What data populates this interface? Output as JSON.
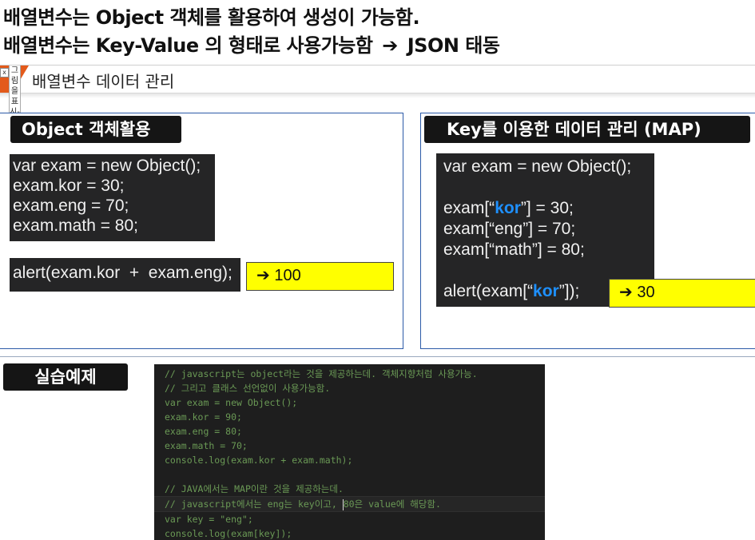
{
  "headings": {
    "line1": "배열변수는 Object 객체를 활용하여 생성이 가능함.",
    "line2_part1": "배열변수는 Key-Value 의 형태로 사용가능함",
    "line2_arrow": "➔",
    "line2_part2": "JSON 태동"
  },
  "section": {
    "title": "배열변수 데이터 관리",
    "tag_close": "x",
    "vertical_text": "그림을표시-어"
  },
  "panel_left": {
    "label": "Object 객체활용",
    "code": [
      "var exam = new Object();",
      "exam.kor = 30;",
      "exam.eng = 70;",
      "exam.math = 80;"
    ],
    "alert_code": "alert(exam.kor  +  exam.eng);",
    "result_arrow": "➔",
    "result_value": "100"
  },
  "panel_right": {
    "label": "Key를 이용한 데이터 관리 (MAP)",
    "line1": "var exam = new Object();",
    "line2_pre": "exam[“",
    "line2_key": "kor",
    "line2_post": "”] = 30;",
    "line3": "exam[“eng”] = 70;",
    "line4": "exam[“math”] = 80;",
    "line5_pre": "alert(exam[“",
    "line5_key": "kor",
    "line5_post": "”]);",
    "result_arrow": "➔",
    "result_value": "30"
  },
  "practice": {
    "label": "실습예제",
    "editor_lines": [
      "// javascript는 object라는 것을 제공하는데. 객체지향처럼 사용가능.",
      "// 그리고 클래스 선언없이 사용가능함.",
      "var exam = new Object();",
      "exam.kor = 90;",
      "exam.eng = 80;",
      "exam.math = 70;",
      "console.log(exam.kor + exam.math);",
      "",
      "// JAVA에서는 MAP이란 것을 제공하는데.",
      "// javascript에서는 eng는 key이고, ",
      "80은 value에 해당함.",
      "var key = \"eng\";",
      "console.log(exam[key]);"
    ]
  },
  "colors": {
    "code_bg": "#252526",
    "editor_bg": "#1e1e1e",
    "editor_text": "#6a9955",
    "highlight": "#ffff00",
    "key_blue": "#1e90ff",
    "panel_border": "#2c5aa8",
    "tag_orange": "#e35a1b"
  }
}
